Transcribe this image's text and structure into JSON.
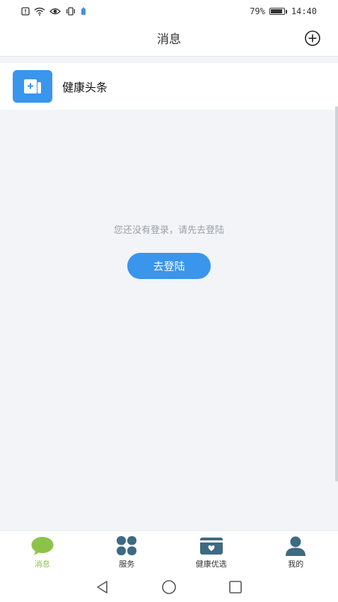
{
  "status_bar": {
    "battery_text": "79%",
    "battery_level": 0.79,
    "time": "14:40"
  },
  "header": {
    "title": "消息"
  },
  "news": {
    "label": "健康头条"
  },
  "empty_state": {
    "message": "您还没有登录，请先去登陆",
    "button_label": "去登陆"
  },
  "bottom_nav": {
    "items": [
      {
        "label": "消息",
        "icon": "chat-bubble-icon",
        "active": true
      },
      {
        "label": "服务",
        "icon": "clover-icon",
        "active": false
      },
      {
        "label": "健康优选",
        "icon": "card-heart-icon",
        "active": false
      },
      {
        "label": "我的",
        "icon": "person-icon",
        "active": false
      }
    ]
  },
  "colors": {
    "accent": "#3a95ec",
    "active_nav": "#8bc34a",
    "nav_icon": "#3e6a82"
  }
}
